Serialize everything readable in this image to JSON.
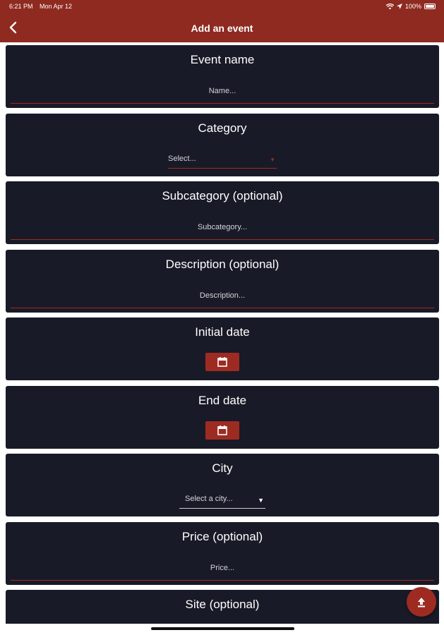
{
  "status_bar": {
    "time": "6:21 PM",
    "date": "Mon Apr 12",
    "battery": "100%"
  },
  "app_bar": {
    "title": "Add an event",
    "back_icon": "chevron-left-icon"
  },
  "form": {
    "event_name": {
      "label": "Event name",
      "placeholder": "Name..."
    },
    "category": {
      "label": "Category",
      "selected": "Select..."
    },
    "subcategory": {
      "label": "Subcategory (optional)",
      "placeholder": "Subcategory..."
    },
    "description": {
      "label": "Description (optional)",
      "placeholder": "Description..."
    },
    "initial_date": {
      "label": "Initial date",
      "icon": "calendar-icon"
    },
    "end_date": {
      "label": "End date",
      "icon": "calendar-icon"
    },
    "city": {
      "label": "City",
      "selected": "Select a city..."
    },
    "price": {
      "label": "Price (optional)",
      "placeholder": "Price..."
    },
    "site": {
      "label": "Site (optional)"
    }
  },
  "fab": {
    "icon": "upload-icon"
  },
  "colors": {
    "accent": "#9e2b22",
    "header": "#8f2a20",
    "card": "#191a27"
  }
}
